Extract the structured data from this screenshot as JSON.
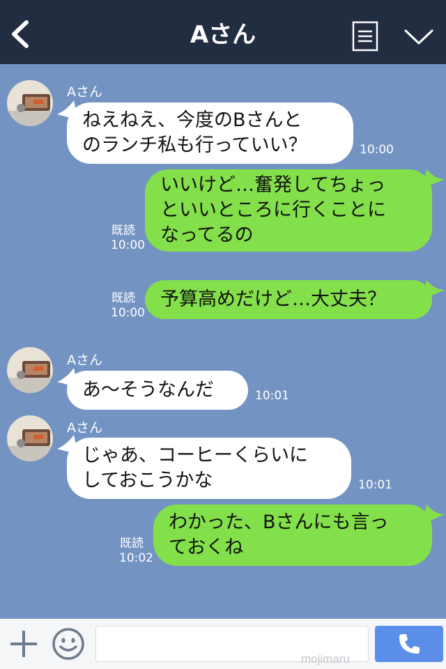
{
  "header": {
    "title": "Aさん",
    "icons": [
      "back-arrow-icon",
      "menu-list-icon",
      "chevron-down-icon"
    ]
  },
  "messages": [
    {
      "sender": "Aさん",
      "direction": "in",
      "text": "ねえねえ、今度のBさんと\nのランチ私も行っていい？",
      "time": "10:00"
    },
    {
      "direction": "out",
      "text": "いいけど…奮発してちょっ\nといいところに行くことに\nなってるの",
      "read": "既読",
      "time": "10:00"
    },
    {
      "direction": "out",
      "text": "予算高めだけど…大丈夫？",
      "read": "既読",
      "time": "10:00"
    },
    {
      "sender": "Aさん",
      "direction": "in",
      "text": "あ〜そうなんだ",
      "time": "10:01"
    },
    {
      "sender": "Aさん",
      "direction": "in",
      "text": "じゃあ、コーヒーくらいに\nしておこうかな",
      "time": "10:01"
    },
    {
      "direction": "out",
      "text": "わかった、Bさんにも言っ\nておくね",
      "read": "既読",
      "time": "10:02"
    }
  ],
  "footer": {
    "input_value": "",
    "watermark": "mojimaru",
    "icons": [
      "plus-icon",
      "emoji-icon",
      "phone-icon"
    ]
  },
  "colors": {
    "header_bg": "#232d42",
    "chat_bg": "#7393c2",
    "incoming_bubble": "#ffffff",
    "outgoing_bubble": "#84e04a",
    "call_button": "#5b8ee8"
  }
}
